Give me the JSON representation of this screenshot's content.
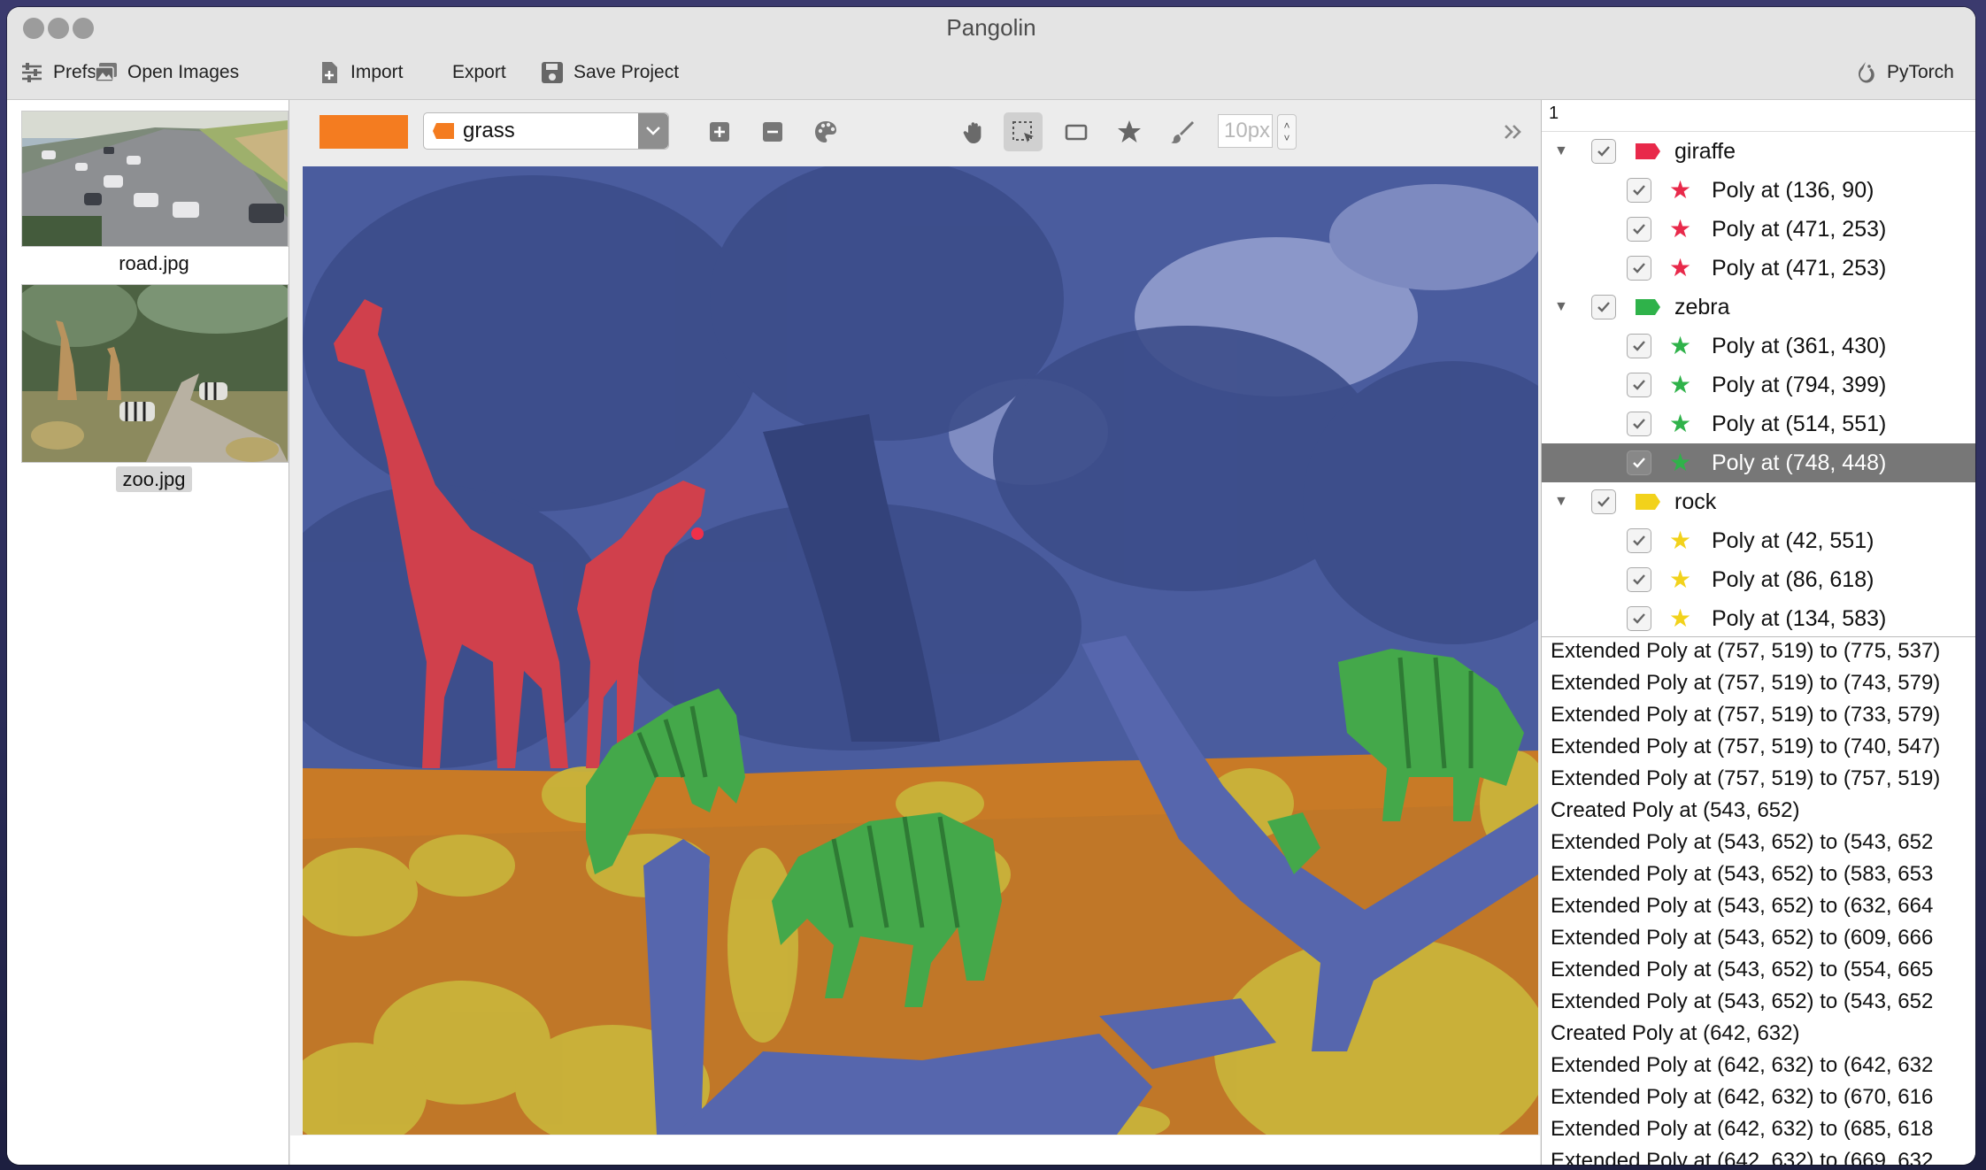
{
  "window": {
    "title": "Pangolin"
  },
  "toolbar": {
    "prefs": "Prefs",
    "open_images": "Open Images",
    "import": "Import",
    "export": "Export",
    "save_project": "Save Project",
    "pytorch": "PyTorch"
  },
  "images": [
    {
      "name": "road.jpg",
      "selected": false
    },
    {
      "name": "zoo.jpg",
      "selected": true
    }
  ],
  "label_bar": {
    "current_color": "#f47c20",
    "current_label": "grass",
    "brush_size": "10px"
  },
  "tools": [
    "pan-tool",
    "select-tool",
    "box-tool",
    "polygon-tool",
    "brush-tool"
  ],
  "active_tool": "select-tool",
  "annotations": {
    "header": "1",
    "labels": [
      {
        "name": "giraffe",
        "color": "#e8294a",
        "shapes": [
          "Poly at (136, 90)",
          "Poly at (471, 253)",
          "Poly at (471, 253)"
        ]
      },
      {
        "name": "zebra",
        "color": "#2fb24a",
        "shapes": [
          "Poly at (361, 430)",
          "Poly at (794, 399)",
          "Poly at (514, 551)",
          "Poly at (748, 448)"
        ]
      },
      {
        "name": "rock",
        "color": "#f2d21b",
        "shapes": [
          "Poly at (42, 551)",
          "Poly at (86, 618)",
          "Poly at (134, 583)"
        ]
      }
    ],
    "selected_shape": "Poly at (748, 448)"
  },
  "history": [
    "Extended Poly at (757, 519) to (775, 537)",
    "Extended Poly at (757, 519) to (743, 579)",
    "Extended Poly at (757, 519) to (733, 579)",
    "Extended Poly at (757, 519) to (740, 547)",
    "Extended Poly at (757, 519) to (757, 519)",
    "Created Poly at (543, 652)",
    "Extended Poly at (543, 652) to (543, 652",
    "Extended Poly at (543, 652) to (583, 653",
    "Extended Poly at (543, 652) to (632, 664",
    "Extended Poly at (543, 652) to (609, 666",
    "Extended Poly at (543, 652) to (554, 665",
    "Extended Poly at (543, 652) to (543, 652",
    "Created Poly at (642, 632)",
    "Extended Poly at (642, 632) to (642, 632",
    "Extended Poly at (642, 632) to (670, 616",
    "Extended Poly at (642, 632) to (685, 618",
    "Extended Poly at (642, 632) to (669, 632"
  ]
}
